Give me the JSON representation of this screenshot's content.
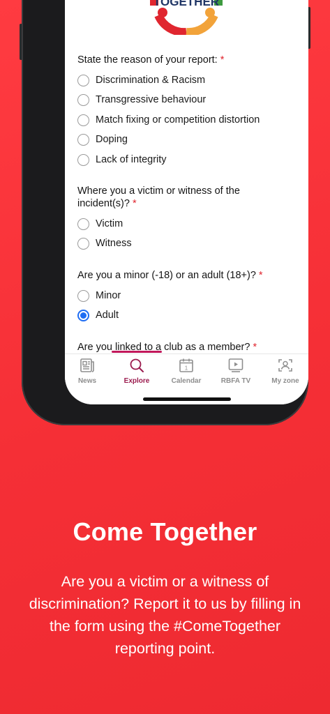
{
  "logo": {
    "text": "TOGETHER"
  },
  "form": {
    "q1": {
      "label": "State the reason of your report:",
      "required": "*",
      "options": [
        "Discrimination & Racism",
        "Transgressive behaviour",
        "Match fixing or competition distortion",
        "Doping",
        "Lack of integrity"
      ]
    },
    "q2": {
      "label": "Where you a victim or witness of the incident(s)?",
      "required": "*",
      "options": [
        "Victim",
        "Witness"
      ]
    },
    "q3": {
      "label": "Are you a minor (-18) or an adult (18+)?",
      "required": "*",
      "options": [
        "Minor",
        "Adult"
      ],
      "selected": "Adult"
    },
    "q4": {
      "label": "Are you linked to a club as a member?",
      "required": "*"
    }
  },
  "nav": {
    "items": [
      {
        "label": "News",
        "icon": "news-icon",
        "active": false
      },
      {
        "label": "Explore",
        "icon": "search-icon",
        "active": true
      },
      {
        "label": "Calendar",
        "icon": "calendar-icon",
        "active": false,
        "icon_text": "1"
      },
      {
        "label": "RBFA TV",
        "icon": "tv-play-icon",
        "active": false
      },
      {
        "label": "My zone",
        "icon": "user-scan-icon",
        "active": false
      }
    ]
  },
  "marketing": {
    "headline": "Come Together",
    "body": "Are you a victim or a witness of discrimination? Report it to us by filling in the form using the #ComeTogether reporting point."
  },
  "colors": {
    "background": "#f5343a",
    "accent": "#9b1b4e",
    "radio_selected": "#1f6df3",
    "required": "#e0262f"
  }
}
